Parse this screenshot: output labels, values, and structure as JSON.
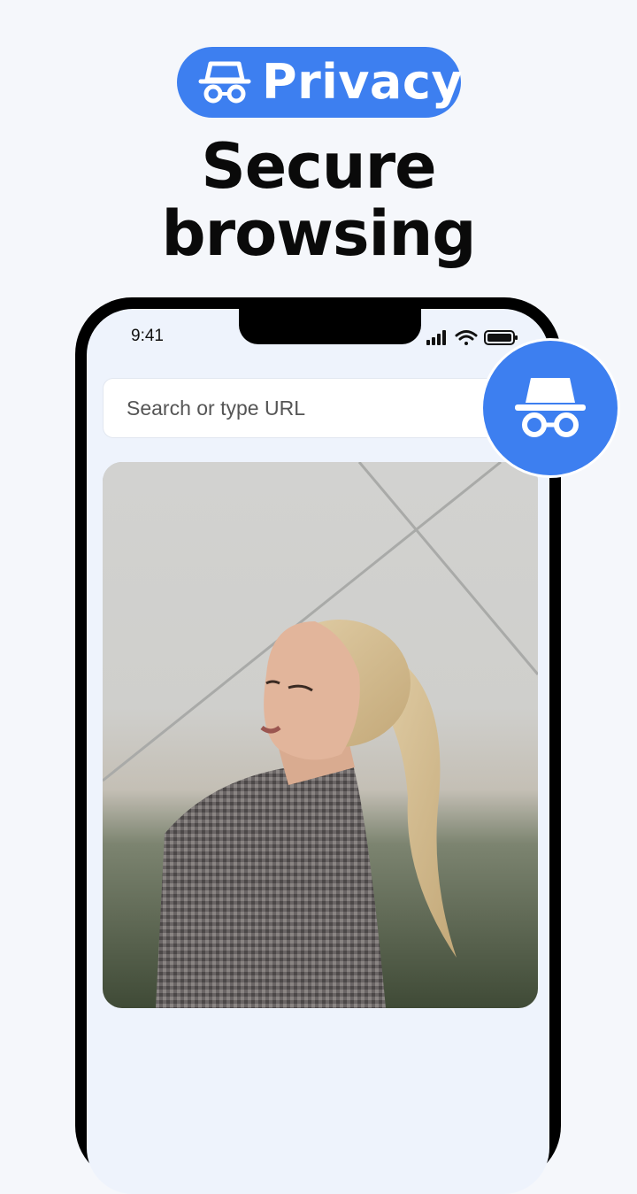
{
  "badge": {
    "label": "Privacy",
    "icon": "incognito-icon",
    "color": "#3d7ff0"
  },
  "headline": {
    "line1": "Secure",
    "line2": "browsing"
  },
  "status_bar": {
    "time": "9:41",
    "icons": [
      "signal-icon",
      "wifi-icon",
      "battery-icon"
    ]
  },
  "search": {
    "placeholder": "Search or type URL"
  },
  "floating_button": {
    "icon": "incognito-icon"
  },
  "photo": {
    "subject": "portrait-photo"
  }
}
